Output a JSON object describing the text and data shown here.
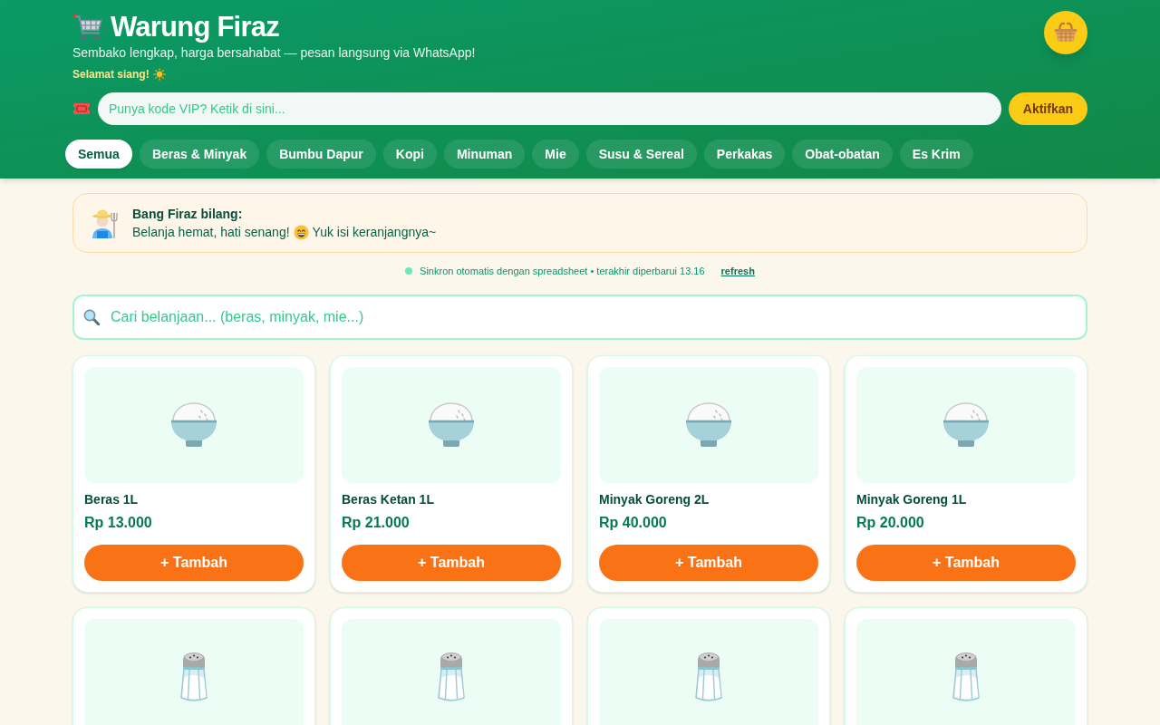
{
  "header": {
    "title": "Warung Firaz",
    "tagline": "Sembako lengkap, harga bersahabat — pesan langsung via WhatsApp!",
    "greeting": "Selamat siang!",
    "vip": {
      "placeholder": "Punya kode VIP? Ketik di sini...",
      "button": "Aktifkan"
    }
  },
  "categories": [
    {
      "label": "Semua",
      "selected": true
    },
    {
      "label": "Beras & Minyak",
      "selected": false
    },
    {
      "label": "Bumbu Dapur",
      "selected": false
    },
    {
      "label": "Kopi",
      "selected": false
    },
    {
      "label": "Minuman",
      "selected": false
    },
    {
      "label": "Mie",
      "selected": false
    },
    {
      "label": "Susu & Sereal",
      "selected": false
    },
    {
      "label": "Perkakas",
      "selected": false
    },
    {
      "label": "Obat-obatan",
      "selected": false
    },
    {
      "label": "Es Krim",
      "selected": false
    }
  ],
  "notice": {
    "title": "Bang Firaz bilang:",
    "message_before": "Belanja hemat, hati senang!",
    "message_after": "Yuk isi keranjangnya~"
  },
  "sync": {
    "text": "Sinkron otomatis dengan spreadsheet • terakhir diperbarui 13.16",
    "link": "refresh"
  },
  "search": {
    "placeholder": "Cari belanjaan... (beras, minyak, mie...)"
  },
  "products": [
    {
      "kind": "rice",
      "name": "Beras 1L",
      "price": "Rp 13.000",
      "button": "+ Tambah"
    },
    {
      "kind": "rice",
      "name": "Beras Ketan 1L",
      "price": "Rp 21.000",
      "button": "+ Tambah"
    },
    {
      "kind": "rice",
      "name": "Minyak Goreng 2L",
      "price": "Rp 40.000",
      "button": "+ Tambah"
    },
    {
      "kind": "rice",
      "name": "Minyak Goreng 1L",
      "price": "Rp 20.000",
      "button": "+ Tambah"
    },
    {
      "kind": "salt"
    },
    {
      "kind": "salt"
    },
    {
      "kind": "salt"
    },
    {
      "kind": "salt"
    }
  ]
}
